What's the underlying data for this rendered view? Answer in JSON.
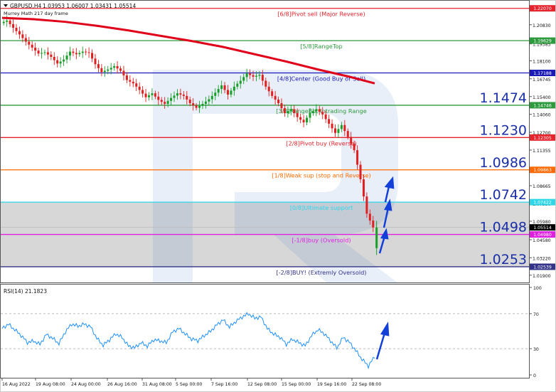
{
  "header": {
    "symbol": "GBPUSD,H4",
    "ohlc": "1.03953 1.06007 1.03431 1.05514",
    "indicator_label": "Murrey Math 217 day frame"
  },
  "chart_data": [
    {
      "type": "candlestick",
      "symbol": "GBPUSD",
      "timeframe": "H4",
      "ylim": [
        1.013,
        1.227
      ],
      "x_tick_labels": [
        "16 Aug 2022",
        "19 Aug 08:00",
        "24 Aug 00:00",
        "26 Aug 16:00",
        "31 Aug 08:00",
        "5 Sep 00:00",
        "7 Sep 16:00",
        "12 Sep 08:00",
        "15 Sep 00:00",
        "19 Sep 16:00",
        "22 Sep 08:00"
      ],
      "y_tick_labels": [
        "1.20830",
        "1.19385",
        "1.18100",
        "1.16745",
        "1.15400",
        "1.14060",
        "1.12700",
        "1.11355",
        "1.10000",
        "1.08665",
        "1.07330",
        "1.05980",
        "1.04580",
        "1.03220",
        "1.01900"
      ],
      "murrey_levels": [
        {
          "label": "[6/8]Pivot sell (Major Reverse)",
          "value": 1.2207,
          "price_text": "1.22070",
          "color": "#e8232b"
        },
        {
          "label": "[5/8]RangeTop",
          "value": 1.19629,
          "price_text": "1.19629",
          "color": "#2e9a3e"
        },
        {
          "label": "[4/8]Center (Good Buy or Sell)",
          "value": 1.17188,
          "price_text": "1.17188",
          "color": "#1a1ab8"
        },
        {
          "label": "[3/8]RangeBot Intrading Range",
          "value": 1.14746,
          "price_text": "1.14746",
          "color": "#2e9a3e"
        },
        {
          "label": "[2/8]Pivot buy (Reverse)",
          "value": 1.12305,
          "price_text": "1.12305",
          "color": "#e8232b"
        },
        {
          "label": "[1/8]Weak sup (stop and Reverse)",
          "value": 1.09863,
          "price_text": "1.09863",
          "color": "#ff6a00"
        },
        {
          "label": "[0/8]Ultimate support",
          "value": 1.07422,
          "price_text": "1.07422",
          "color": "#2fd6e8"
        },
        {
          "label": "[-1/8]buy (Oversold)",
          "value": 1.0498,
          "price_text": "1.04980",
          "color": "#e020e0"
        },
        {
          "label": "[-2/8]BUY! (Extremly Oversold)",
          "value": 1.02539,
          "price_text": "1.02539",
          "color": "#333388"
        }
      ],
      "large_level_labels": [
        "1.1474",
        "1.1230",
        "1.0986",
        "1.0742",
        "1.0498",
        "1.0253"
      ],
      "current_price": {
        "value": 1.05514,
        "text": "1.05514"
      },
      "moving_average": {
        "name": "217-period MA",
        "color": "#e0001a",
        "x": [
          0,
          10,
          20,
          30,
          40,
          50,
          60,
          70,
          80,
          90,
          100,
          110,
          118
        ],
        "values": [
          1.2135,
          1.2125,
          1.2105,
          1.2075,
          1.204,
          1.2,
          1.196,
          1.1915,
          1.186,
          1.1805,
          1.1745,
          1.169,
          1.164
        ]
      },
      "price_path": {
        "x": [
          0,
          2,
          4,
          6,
          8,
          10,
          12,
          14,
          16,
          18,
          20,
          22,
          24,
          26,
          28,
          30,
          32,
          34,
          36,
          38,
          40,
          42,
          44,
          46,
          48,
          50,
          52,
          54,
          56,
          58,
          60,
          62,
          64,
          66,
          68,
          70,
          72,
          74,
          76,
          78,
          80,
          82,
          84,
          86,
          88,
          90,
          92,
          94,
          96,
          98,
          100,
          102,
          104,
          106,
          108,
          110,
          112,
          114,
          116,
          118
        ],
        "values": [
          1.2095,
          1.2115,
          1.206,
          1.201,
          1.1955,
          1.191,
          1.1865,
          1.1875,
          1.184,
          1.179,
          1.182,
          1.188,
          1.186,
          1.188,
          1.187,
          1.1785,
          1.1725,
          1.1745,
          1.177,
          1.1735,
          1.1665,
          1.164,
          1.159,
          1.1535,
          1.1565,
          1.1515,
          1.1485,
          1.153,
          1.1565,
          1.1545,
          1.149,
          1.1455,
          1.1485,
          1.152,
          1.157,
          1.1625,
          1.1555,
          1.1615,
          1.166,
          1.1715,
          1.169,
          1.1705,
          1.1615,
          1.1545,
          1.149,
          1.1415,
          1.1445,
          1.1385,
          1.1345,
          1.1415,
          1.1445,
          1.1405,
          1.1335,
          1.1265,
          1.1325,
          1.1235,
          1.1135,
          1.0915,
          1.0655,
          1.0551
        ]
      },
      "annotations": [
        "three blue up arrows near the final candle"
      ]
    },
    {
      "type": "line",
      "title": "RSI(14) 21.1823",
      "ylim": [
        0,
        100
      ],
      "y_tick_labels": [
        "100",
        "70",
        "30",
        "0"
      ],
      "levels": [
        70,
        30
      ],
      "x": [
        0,
        2,
        4,
        6,
        8,
        10,
        12,
        14,
        16,
        18,
        20,
        22,
        24,
        26,
        28,
        30,
        32,
        34,
        36,
        38,
        40,
        42,
        44,
        46,
        48,
        50,
        52,
        54,
        56,
        58,
        60,
        62,
        64,
        66,
        68,
        70,
        72,
        74,
        76,
        78,
        80,
        82,
        84,
        86,
        88,
        90,
        92,
        94,
        96,
        98,
        100,
        102,
        104,
        106,
        108,
        110,
        112,
        114,
        116,
        118
      ],
      "values": [
        53,
        58,
        52,
        45,
        37,
        39,
        35,
        46,
        42,
        36,
        49,
        58,
        56,
        58,
        55,
        42,
        34,
        40,
        47,
        43,
        33,
        31,
        37,
        33,
        40,
        39,
        37,
        49,
        53,
        47,
        41,
        39,
        45,
        50,
        57,
        63,
        55,
        61,
        66,
        70,
        65,
        66,
        53,
        47,
        43,
        35,
        41,
        37,
        33,
        45,
        52,
        47,
        39,
        31,
        43,
        37,
        28,
        18,
        10,
        21
      ],
      "annotations": [
        "blue up arrow"
      ]
    }
  ]
}
